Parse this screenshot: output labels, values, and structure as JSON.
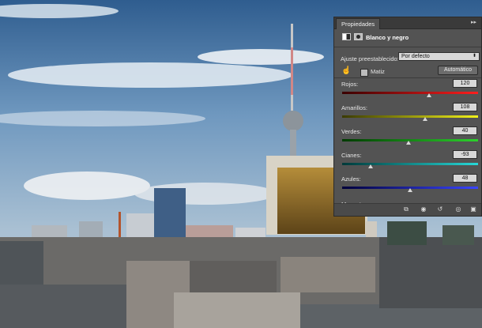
{
  "panel": {
    "tab_label": "Propiedades",
    "collapse_icon": "double-chevron-right-icon",
    "title": "Blanco y negro",
    "preset_label": "Ajuste preestablecido:",
    "preset_value": "Por defecto",
    "tint_label": "Matiz",
    "tint_checked": false,
    "auto_button": "Automático",
    "sliders": [
      {
        "label": "Rojos:",
        "value": "120",
        "level": 0.64,
        "gradient": [
          "#3a0000",
          "#ff1e1e"
        ]
      },
      {
        "label": "Amarillos:",
        "value": "108",
        "level": 0.61,
        "gradient": [
          "#3a3a00",
          "#f2f21a"
        ]
      },
      {
        "label": "Verdes:",
        "value": "40",
        "level": 0.49,
        "gradient": [
          "#003a00",
          "#2cd12c"
        ]
      },
      {
        "label": "Cianes:",
        "value": "-93",
        "level": 0.21,
        "gradient": [
          "#003a3a",
          "#27d7d7"
        ]
      },
      {
        "label": "Azules:",
        "value": "48",
        "level": 0.5,
        "gradient": [
          "#00003a",
          "#3a45ff"
        ]
      }
    ],
    "partial_label": "Magentas:",
    "bottom_icons": [
      "clip-to-layer-icon",
      "view-previous-icon",
      "reset-icon",
      "visibility-eye-icon",
      "trash-icon"
    ]
  }
}
